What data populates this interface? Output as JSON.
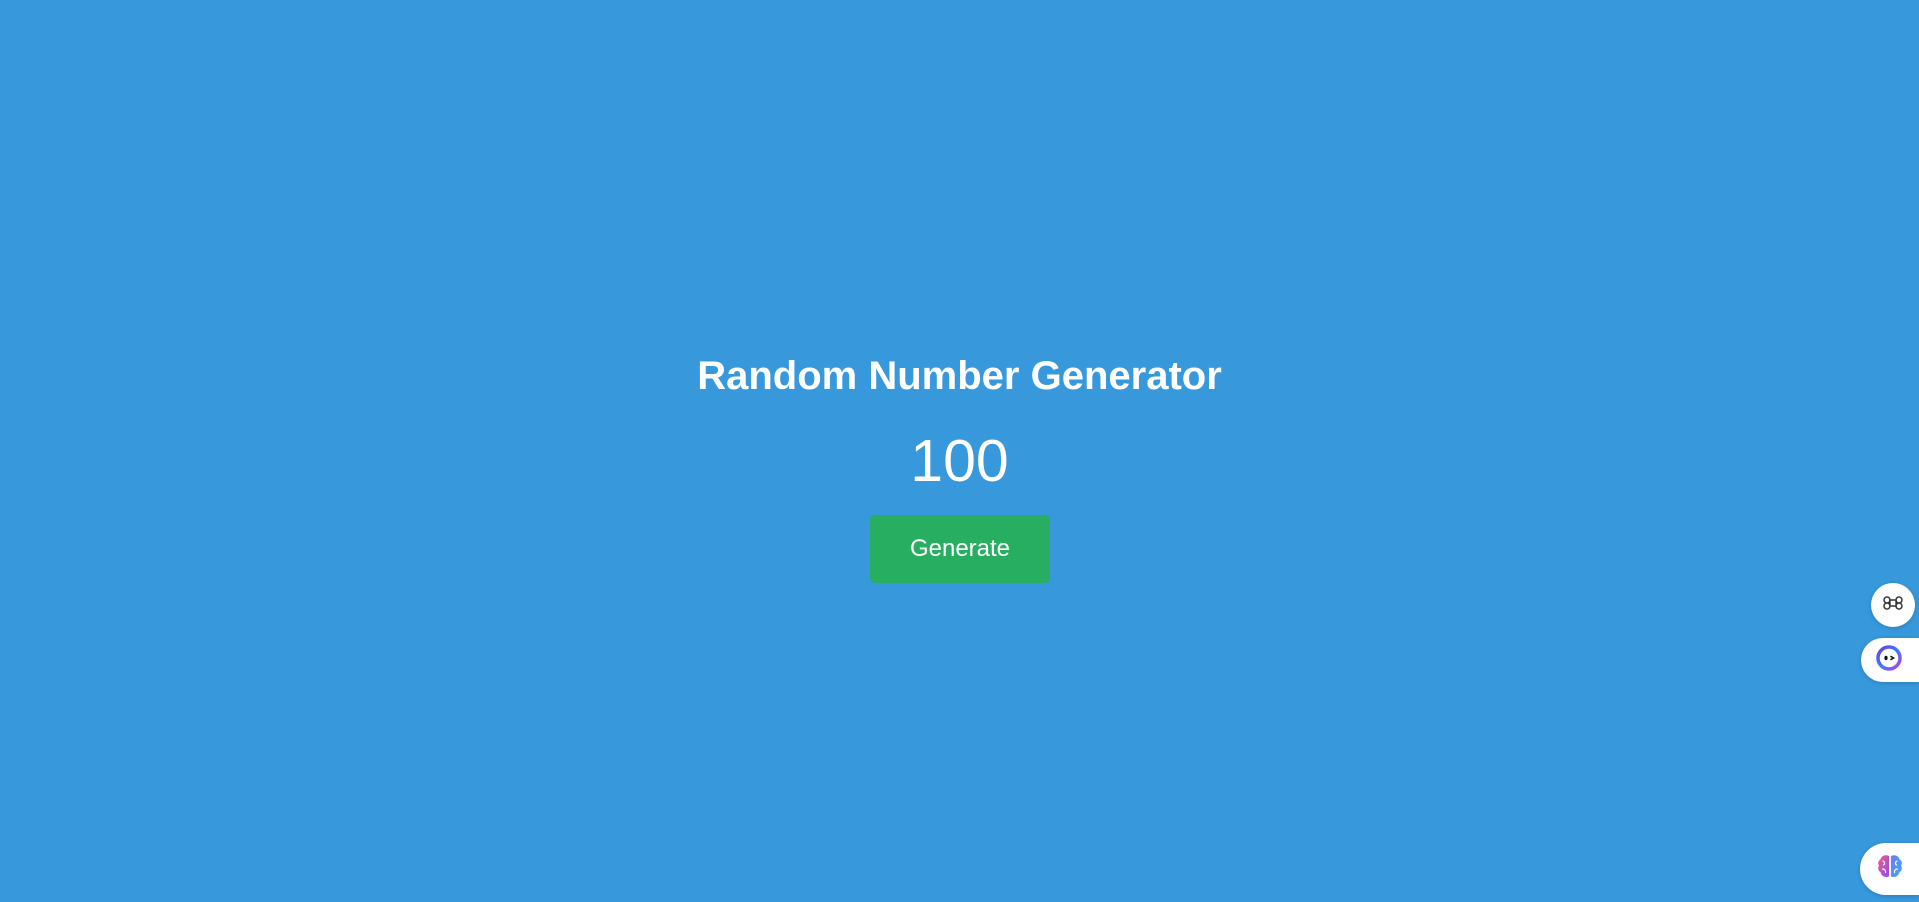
{
  "app": {
    "title": "Random Number Generator",
    "current_number": "100",
    "generate_label": "Generate"
  },
  "colors": {
    "background": "#3798db",
    "button": "#27ae60",
    "text": "#ffffff"
  },
  "side_widgets": {
    "shortcuts_icon": "command-icon",
    "assistant_icon": "assistant-face-icon",
    "brain_icon": "brain-icon"
  }
}
